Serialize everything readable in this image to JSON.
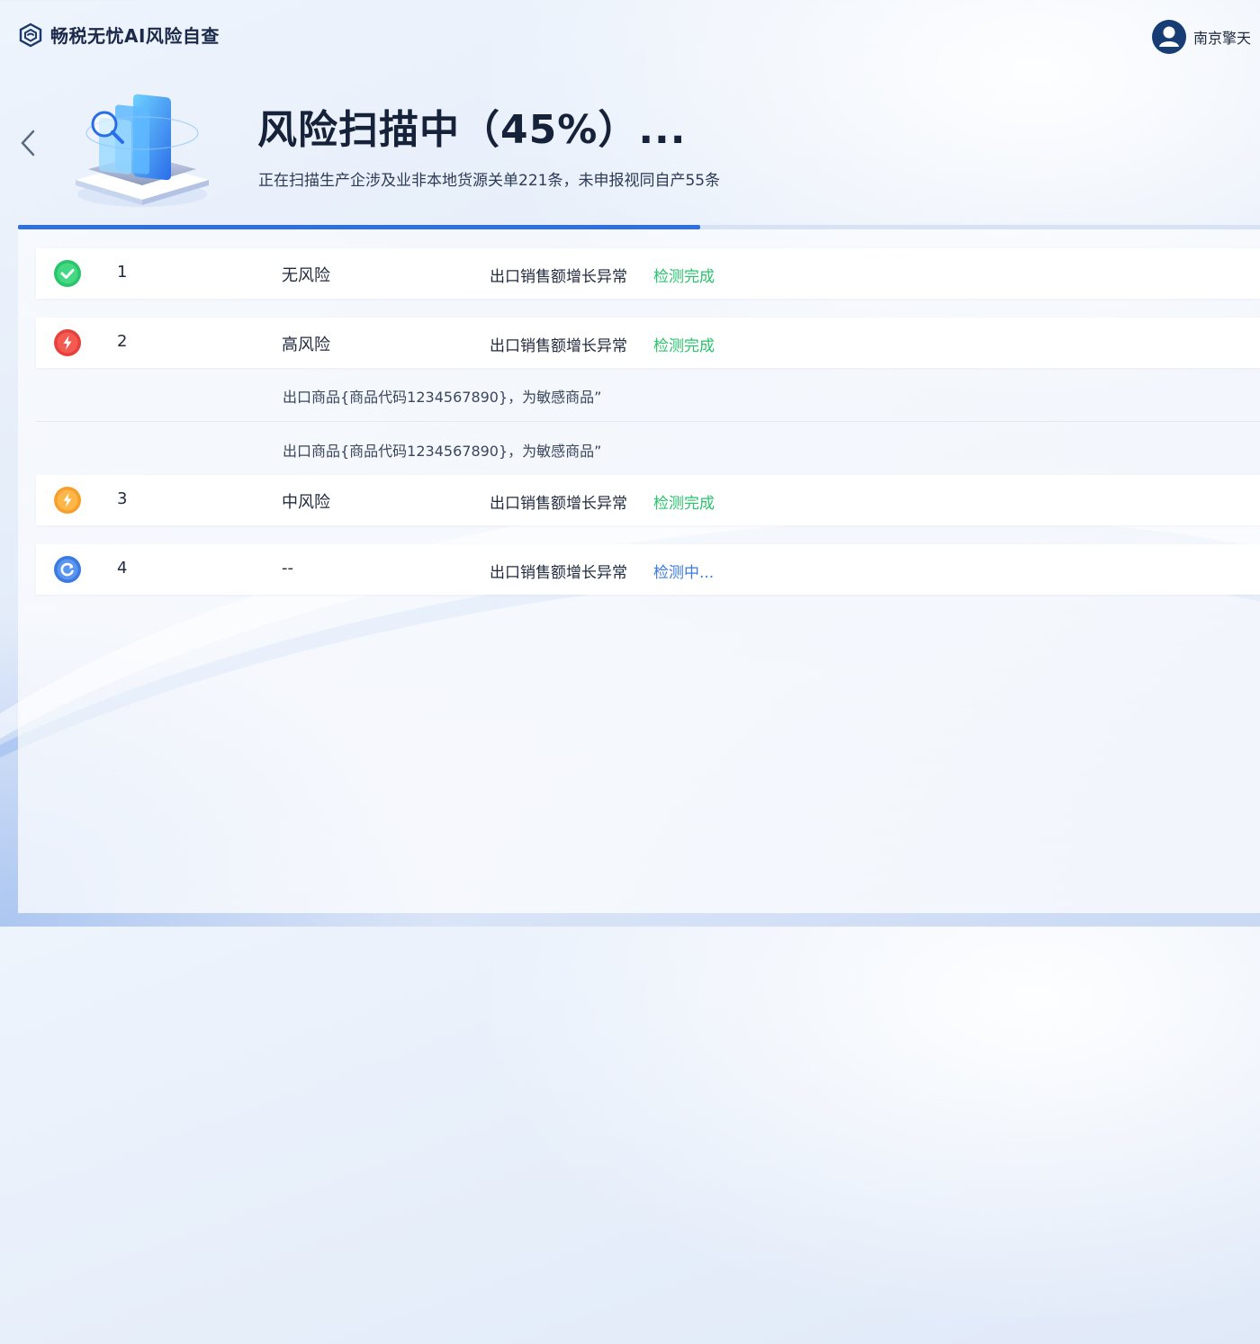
{
  "header": {
    "app_title": "畅税无忧AI风险自查",
    "user_name": "南京擎天"
  },
  "hero": {
    "title": "风险扫描中（45%）...",
    "subtitle": "正在扫描生产企涉及业非本地货源关单221条，未申报视同自产55条",
    "progress_percent": 45
  },
  "colors": {
    "accent": "#2f6fe0",
    "success": "#29c46b",
    "danger": "#e8413c",
    "warning": "#f6a02b",
    "running": "#3b7be0"
  },
  "rows": [
    {
      "index": "1",
      "level": "无风险",
      "item": "出口销售额增长异常",
      "state": "检测完成",
      "icon": "check-circle-icon"
    },
    {
      "index": "2",
      "level": "高风险",
      "item": "出口销售额增长异常",
      "state": "检测完成",
      "icon": "lightning-red-icon"
    },
    {
      "index": "3",
      "level": "中风险",
      "item": "出口销售额增长异常",
      "state": "检测完成",
      "icon": "lightning-orange-icon"
    },
    {
      "index": "4",
      "level": "--",
      "item": "出口销售额增长异常",
      "state": "检测中...",
      "icon": "refresh-icon"
    }
  ],
  "details": [
    "出口商品{商品代码1234567890}，为敏感商品”",
    "出口商品{商品代码1234567890}，为敏感商品”"
  ]
}
